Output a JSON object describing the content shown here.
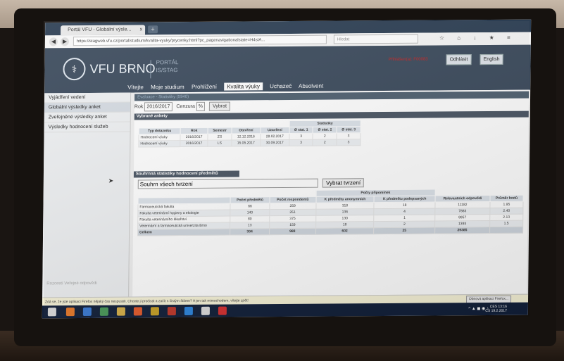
{
  "browser": {
    "tab_title": "Portál VFU - Globální výsle...",
    "tab_close": "x",
    "newtab": "+",
    "url": "https://stagweb.vfu.cz/portal/studium/kvalita-vyuky/prycenky.html?pc_pagenavigationalstate=H4sIA...",
    "search_placeholder": "Hledat",
    "toolbar_icons": "☆ ⌂ ↓ ★ ≡"
  },
  "header": {
    "brand": "VFU BRNO",
    "portal_line1": "PORTÁL",
    "portal_line2": "IS/STAG",
    "login_note": "Přihlášen(a): F00083",
    "logout_label": "Odhlásit",
    "lang_label": "English"
  },
  "menu": {
    "items": [
      "Vítejte",
      "Moje studium",
      "Prohlížení",
      "Kvalita výuky",
      "Uchazeč",
      "Absolvent"
    ],
    "active": "Kvalita výuky"
  },
  "sidebar": {
    "items": [
      "Vyjádření vedení",
      "Globální výsledky anket",
      "Zveřejněné výsledky anket",
      "Výsledky hodnocení služeb"
    ],
    "footer": "Rozcestí Veřejné odpovědi"
  },
  "evaluation": {
    "title": "Evaluace - Statistiky (5940)",
    "year_label": "Rok",
    "year_value": "2016/2017",
    "concept_label": "Cenzura",
    "concept_value": "%",
    "select_button": "Vybrat"
  },
  "surveys": {
    "section_title": "Vybrané ankety",
    "stat_group": "Statistiky",
    "headers": [
      "Typ dotazníku",
      "Rok",
      "Semestr",
      "Otevření",
      "Uzavření",
      "Ø stat. 1",
      "Ø stat. 2",
      "Ø stat. 3"
    ],
    "rows": [
      [
        "Hodnocení výuky",
        "2016/2017",
        "ZS",
        "12.12.2016",
        "28.02.2017",
        "3",
        "2",
        "3"
      ],
      [
        "Hodnocení výuky",
        "2016/2017",
        "LS",
        "15.05.2017",
        "30.09.2017",
        "3",
        "2",
        "3"
      ]
    ]
  },
  "summary": {
    "section_title": "Souhrnná statistiky hodnocení předmětů",
    "filter_value": "Souhrn všech tvrzení",
    "filter_button": "Vybrat tvrzení",
    "group_header": "Počty připomínek",
    "headers": [
      "",
      "Počet předmětů",
      "Počet respondentů",
      "K předmětu anonymních",
      "K předmětu podepsaných",
      "Relevantních odpovědí",
      "Průměr bodů"
    ],
    "rows": [
      [
        "Farmaceutická fakulta",
        "66",
        "259",
        "318",
        "18",
        "11182",
        "1.95"
      ],
      [
        "Fakulta veterinární hygieny a ekologie",
        "140",
        "251",
        "136",
        "4",
        "7883",
        "2.40"
      ],
      [
        "Fakulta veterinárního lékařství",
        "80",
        "375",
        "130",
        "1",
        "8857",
        "2.13"
      ],
      [
        "Veterinární a farmaceutická univerzita Brno",
        "13",
        "159",
        "18",
        "2",
        "1393",
        "1.5"
      ]
    ],
    "total": [
      "Celkem",
      "304",
      "988",
      "602",
      "25",
      "29385",
      ""
    ]
  },
  "notification": {
    "text": "Zdá se, že jste aplikaci Firefox nějaký čas nespustili. Chcete ji pročistit a začít s čistým štítem? A jen tak mimochodem, vítejte zpět!",
    "button": "Obnovit aplikaci Firefox..."
  },
  "taskbar": {
    "lang1": "CES",
    "lang2": "CS",
    "time": "13:16",
    "date": "19.2.2017"
  }
}
